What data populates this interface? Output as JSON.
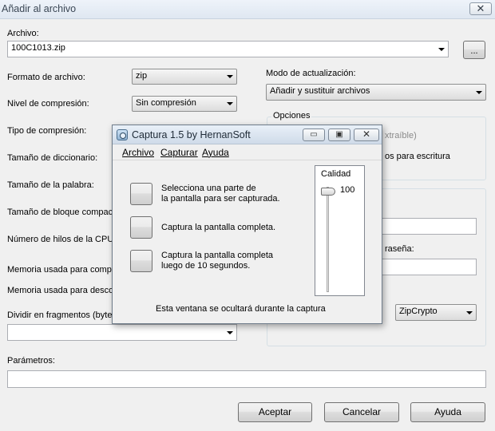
{
  "main_window": {
    "title": "Añadir al archivo",
    "close_glyph": "✕",
    "archivo_label": "Archivo:",
    "archivo_value": "100C1013.zip",
    "browse_label": "...",
    "formato_label": "Formato de archivo:",
    "formato_value": "zip",
    "nivel_label": "Nivel de compresión:",
    "nivel_value": "Sin compresión",
    "tipo_label": "Tipo de compresión:",
    "diccionario_label": "Tamaño de diccionario:",
    "palabra_label": "Tamaño de la palabra:",
    "bloque_label": "Tamaño de bloque compact",
    "hilos_label": "Número de hilos de la CPU:",
    "mem_comp_label": "Memoria usada para compri",
    "mem_desc_label": "Memoria usada para descor",
    "dividir_label": "Dividir en fragmentos (bytes):",
    "dividir_value": "",
    "modo_label": "Modo de actualización:",
    "modo_value": "Añadir y sustituir archivos",
    "opciones_label": "Opciones",
    "opcion_extraible_partial": "xtraíble)",
    "opcion_escritura_partial": "os para escritura",
    "contrasena_partial": "raseña:",
    "cifrado_value": "ZipCrypto",
    "parametros_label": "Parámetros:",
    "parametros_value": "",
    "aceptar_label": "Aceptar",
    "cancelar_label": "Cancelar",
    "ayuda_label": "Ayuda"
  },
  "dialog": {
    "title": "Captura 1.5 by HernanSoft",
    "minimize_glyph": "▭",
    "maximize_glyph": "▣",
    "close_glyph": "✕",
    "menu": [
      "Archivo",
      "Capturar",
      "Ayuda"
    ],
    "options": [
      {
        "text": "Selecciona una parte de\nla pantalla para ser capturada."
      },
      {
        "text": "Captura la pantalla completa."
      },
      {
        "text": "Captura la pantalla completa\nluego de 10 segundos."
      }
    ],
    "calidad_label": "Calidad",
    "calidad_value": "100",
    "calidad_level": 1.0,
    "footer_text": "Esta ventana se ocultará durante la captura"
  },
  "colors": {
    "window_bg": "#f0f0f0",
    "title_text": "#3a4654"
  },
  "icons": {
    "dialog_app": "camera-icon",
    "dropdown": "chevron-down-icon"
  }
}
